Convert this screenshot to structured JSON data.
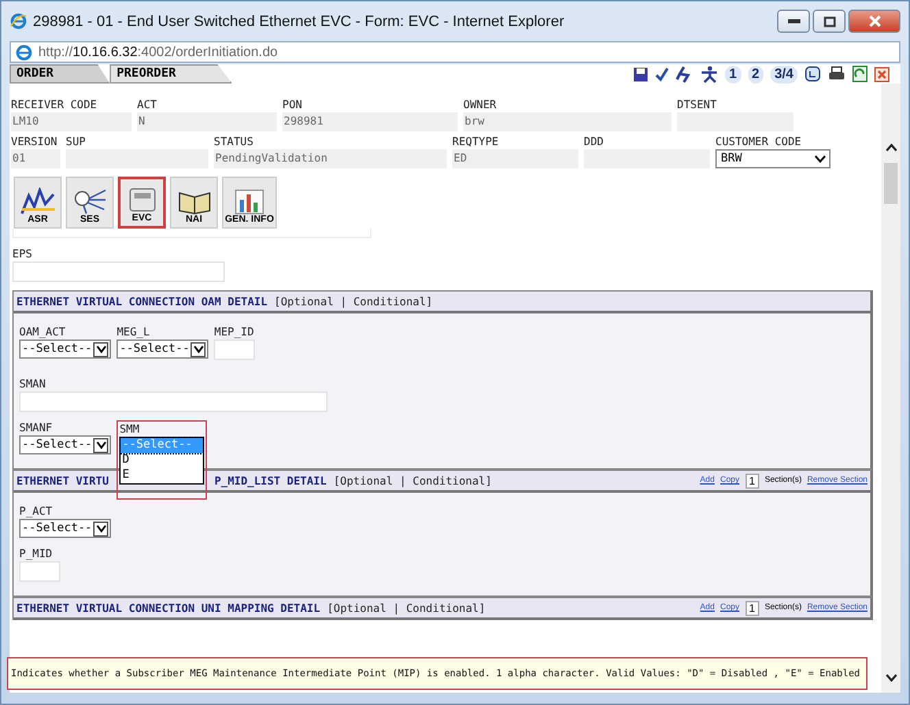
{
  "window": {
    "title": "298981 - 01 - End User Switched Ethernet EVC - Form: EVC - Internet Explorer"
  },
  "address": "http://**10.16.6.32**:4002/orderInitiation.do",
  "tabs": [
    {
      "label": "ORDER",
      "selected": true
    },
    {
      "label": "PREORDER",
      "selected": false
    }
  ],
  "toolbar_numbers": [
    "1",
    "2",
    "3/4"
  ],
  "header_rows": [
    [
      {
        "label": "RECEIVER CODE",
        "value": "LM10",
        "kind": "text"
      },
      {
        "label": "ACT",
        "value": "N",
        "kind": "text"
      },
      {
        "label": "PON",
        "value": "298981",
        "kind": "text"
      },
      {
        "label": "OWNER",
        "value": "brw",
        "kind": "text"
      },
      {
        "label": "DTSENT",
        "kind": "text"
      }
    ],
    [
      {
        "label": "VERSION",
        "value": "01",
        "kind": "text"
      },
      {
        "label": "SUP",
        "kind": "text"
      },
      {
        "label": "STATUS",
        "value": "PendingValidation",
        "kind": "text"
      },
      {
        "label": "REQTYPE",
        "value": "ED",
        "kind": "text"
      },
      {
        "label": "DDD",
        "kind": "text"
      },
      {
        "label": "CUSTOMER CODE",
        "value": "BRW",
        "kind": "select"
      }
    ]
  ],
  "form_tabs": [
    {
      "label": "ASR",
      "selected": false
    },
    {
      "label": "SES",
      "selected": false
    },
    {
      "label": "EVC",
      "selected": true
    },
    {
      "label": "NAI",
      "selected": false
    },
    {
      "label": "GEN. INFO",
      "selected": false
    }
  ],
  "eps_label": "EPS",
  "oam_section": {
    "title": "ETHERNET VIRTUAL CONNECTION OAM DETAIL",
    "suffix": "[Optional | Conditional]",
    "row1": [
      {
        "label": "OAM_ACT",
        "value": "--Select--",
        "kind": "select"
      },
      {
        "label": "MEG_L",
        "value": "--Select--",
        "kind": "select"
      },
      {
        "label": "MEP_ID",
        "kind": "text"
      }
    ],
    "sman_label": "SMAN",
    "smanf": {
      "label": "SMANF",
      "value": "--Select--"
    },
    "smm": {
      "label": "SMM",
      "options": [
        {
          "label": "--Select--",
          "selected": true
        },
        {
          "label": "D",
          "selected": false
        },
        {
          "label": "E",
          "selected": false
        }
      ]
    }
  },
  "mip_section": {
    "title_left": "ETHERNET VIRTU",
    "title_right": "P_MID_LIST DETAIL",
    "suffix": "[Optional | Conditional]",
    "links": {
      "add": "Add",
      "copy": "Copy",
      "count": "1",
      "sections": "Section(s)",
      "remove": "Remove Section"
    },
    "p_act": {
      "label": "P_ACT",
      "value": "--Select--"
    },
    "p_mid_label": "P_MID"
  },
  "uni_section": {
    "title": "ETHERNET VIRTUAL CONNECTION UNI MAPPING DETAIL",
    "suffix": "[Optional | Conditional]",
    "links": {
      "add": "Add",
      "copy": "Copy",
      "count": "1",
      "sections": "Section(s)",
      "remove": "Remove Section"
    }
  },
  "help_text": "Indicates whether a Subscriber MEG Maintenance Intermediate Point (MIP) is enabled. 1 alpha character. Valid Values: \"D\" = Disabled , \"E\" = Enabled"
}
